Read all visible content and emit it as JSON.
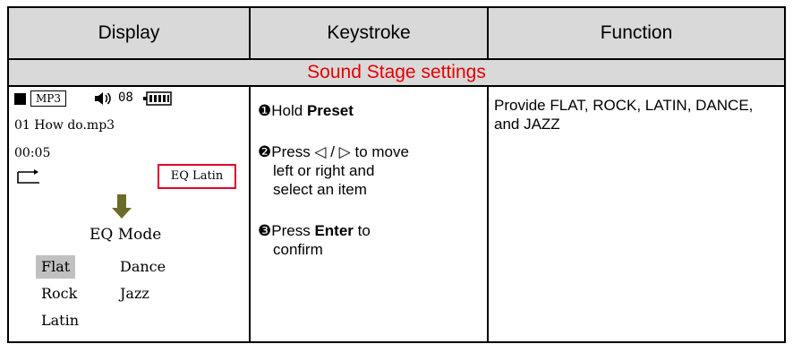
{
  "header": {
    "display": "Display",
    "keystroke": "Keystroke",
    "function": "Function"
  },
  "section_title": "Sound Stage settings",
  "lcd": {
    "mode_badge": "MP3",
    "volume": "08",
    "song": "01 How do.mp3",
    "time": "00:05",
    "eq_status": "EQ Latin",
    "eq_menu_title": "EQ Mode",
    "options": [
      "Flat",
      "Dance",
      "Rock",
      "Jazz",
      "Latin"
    ],
    "selected_option": "Flat",
    "icons": [
      "stop-icon",
      "volume-icon",
      "battery-icon",
      "repeat-icon",
      "down-arrow-icon"
    ],
    "colors": {
      "highlight_box": "#e0002a",
      "arrow": "#6b6b2a",
      "selected_bg": "#c0c0c0"
    }
  },
  "steps": [
    {
      "num": "❶",
      "prefix": "Hold ",
      "bold": "Preset",
      "suffix": ""
    },
    {
      "num": "❷",
      "line1": "Press ◁ / ▷ to move",
      "line2": "left or right and",
      "line3": "select an item"
    },
    {
      "num": "❸",
      "prefix": "Press ",
      "bold": "Enter",
      "suffix": " to",
      "line2": "confirm"
    }
  ],
  "function_text": "Provide FLAT, ROCK, LATIN, DANCE, and JAZZ",
  "colors": {
    "header_bg": "#d9d9d9",
    "section_text": "#e60000"
  }
}
